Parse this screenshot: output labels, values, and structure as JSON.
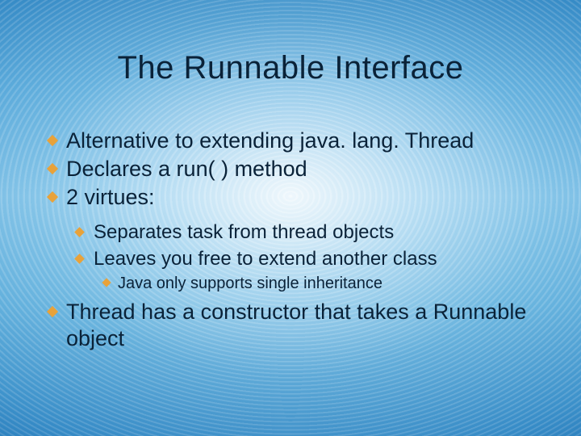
{
  "title": "The Runnable Interface",
  "bullets": {
    "b1": "Alternative to extending java. lang. Thread",
    "b2": "Declares a run( ) method",
    "b3": "2 virtues:",
    "b3a": "Separates task from thread objects",
    "b3b": "Leaves you free to extend another class",
    "b3b1": "Java only supports single inheritance",
    "b4": "Thread has a constructor that takes a Runnable object"
  }
}
